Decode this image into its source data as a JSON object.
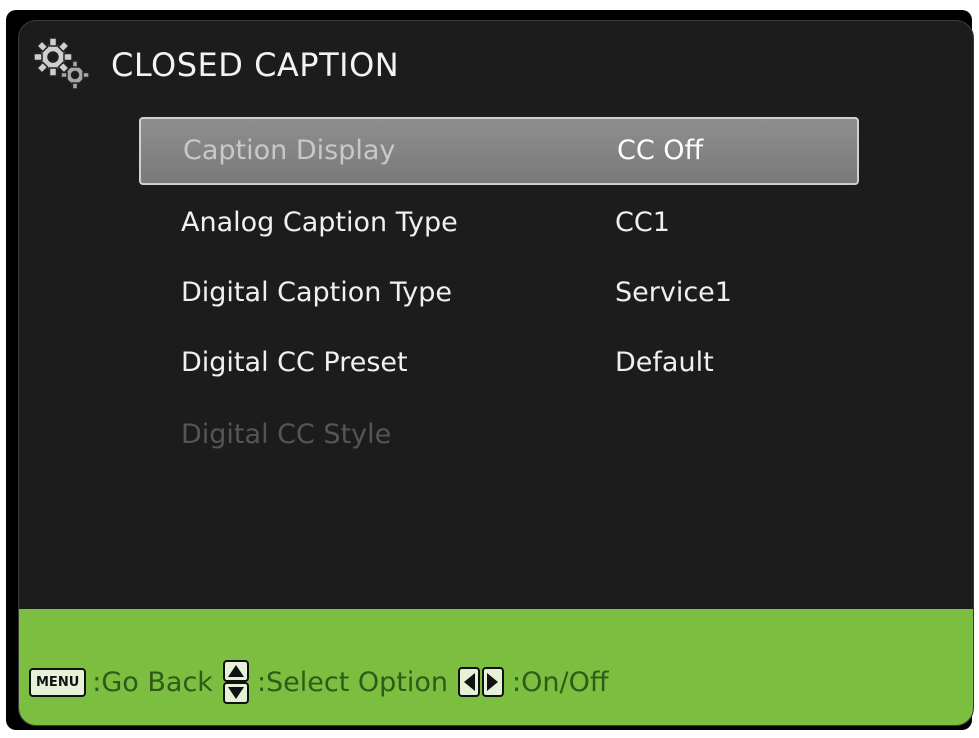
{
  "header": {
    "title": "CLOSED CAPTION",
    "icon": "gears-icon"
  },
  "menu": {
    "items": [
      {
        "label": "Caption Display",
        "value": "CC Off",
        "state": "selected"
      },
      {
        "label": "Analog Caption Type",
        "value": "CC1",
        "state": "normal"
      },
      {
        "label": "Digital Caption Type",
        "value": "Service1",
        "state": "normal"
      },
      {
        "label": "Digital CC Preset",
        "value": "Default",
        "state": "normal"
      },
      {
        "label": "Digital CC Style",
        "value": "",
        "state": "disabled"
      }
    ]
  },
  "footer": {
    "menu_key_label": "MENU",
    "go_back": ":Go Back",
    "select_option": ":Select Option",
    "on_off": ":On/Off"
  },
  "colors": {
    "background": "#1c1c1c",
    "footer": "#7cbe40",
    "footer_text": "#2f5a18",
    "selected_row": "#8a8a8a",
    "disabled_text": "#555555"
  }
}
